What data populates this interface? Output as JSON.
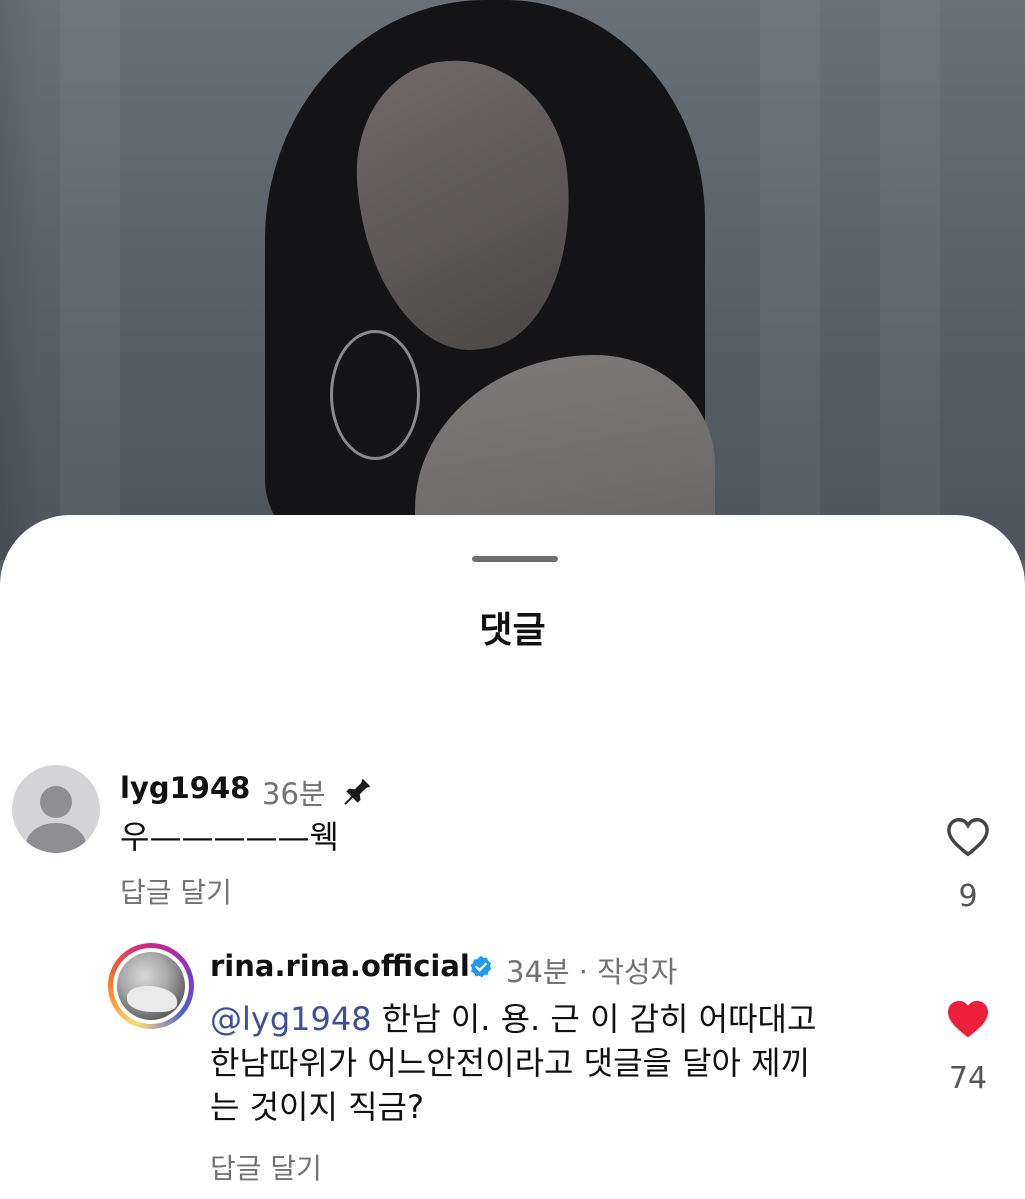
{
  "sheet": {
    "title": "댓글"
  },
  "comments": [
    {
      "username": "lyg1948",
      "time": "36분",
      "pinned": true,
      "text": "우—————웩",
      "reply_label": "답글 달기",
      "likes": "9",
      "liked": false
    }
  ],
  "reply": {
    "username": "rina.rina.official",
    "verified": true,
    "time_meta": "34분 · 작성자",
    "mention": "@lyg1948",
    "text_line1": " 한남 이. 용. 근 이 감히 어따대고",
    "text_line2": "한남따위가 어느안전이라고 댓글을 달아 제끼",
    "text_line3": "는 것이지 직금?",
    "reply_label": "답글 달기",
    "likes": "74",
    "liked": true
  },
  "colors": {
    "heart_liked": "#ed1f3a",
    "verified_badge": "#1d9bf0",
    "mention": "#3d4f9a"
  }
}
